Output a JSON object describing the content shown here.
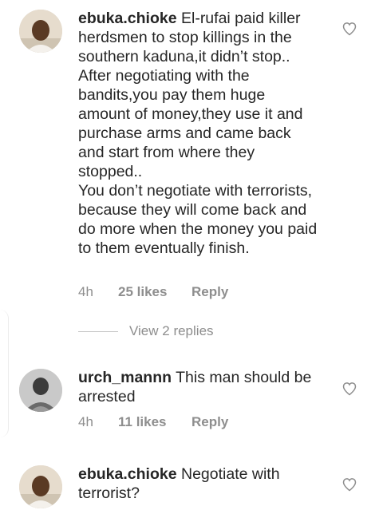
{
  "comments": [
    {
      "username": "ebuka.chioke",
      "text": "El-rufai paid killer herdsmen to stop killings in the southern kaduna,it didn’t stop..\nAfter negotiating with the bandits,you pay them huge amount of money,they use it and purchase arms and came back and start from where they stopped..\nYou don’t negotiate with terrorists, because they will come back and do more when the money you paid to them eventually finish.",
      "time": "4h",
      "likes": "25 likes",
      "reply_label": "Reply"
    },
    {
      "username": "urch_mannn",
      "text": "This man should be arrested",
      "time": "4h",
      "likes": "11 likes",
      "reply_label": "Reply"
    },
    {
      "username": "ebuka.chioke",
      "text": "Negotiate with terrorist?"
    }
  ],
  "view_replies_label": "View 2 replies",
  "icons": {
    "like": "heart-outline-icon"
  },
  "colors": {
    "text": "#262626",
    "secondary": "#8e8e8e",
    "heart_stroke": "#8e8e8e"
  }
}
